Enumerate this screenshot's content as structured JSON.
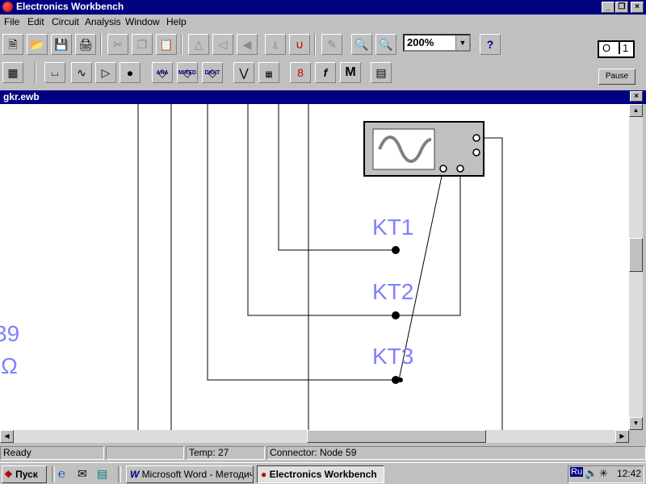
{
  "app": {
    "title": "Electronics Workbench"
  },
  "menu": [
    "File",
    "Edit",
    "Circuit",
    "Analysis",
    "Window",
    "Help"
  ],
  "toolbar": {
    "zoom_value": "200%",
    "help_label": "?",
    "pause_label": "Pause",
    "parts_labels": {
      "analog": "ANA",
      "mixed": "MIXED",
      "digital": "DIGIT",
      "misc": "M"
    }
  },
  "document": {
    "title": "gkr.ewb"
  },
  "circuit": {
    "test_points": [
      "KT1",
      "KT2",
      "KT3"
    ],
    "partial_value": "39",
    "partial_unit": "Ω"
  },
  "status": {
    "state": "Ready",
    "field2": "",
    "temp": "Temp:  27",
    "connector": "Connector: Node 59"
  },
  "taskbar": {
    "start_label": "Пуск",
    "tasks": [
      "Microsoft Word - Методич...",
      "Electronics Workbench"
    ],
    "lang": "Ru",
    "clock": "12:42"
  }
}
